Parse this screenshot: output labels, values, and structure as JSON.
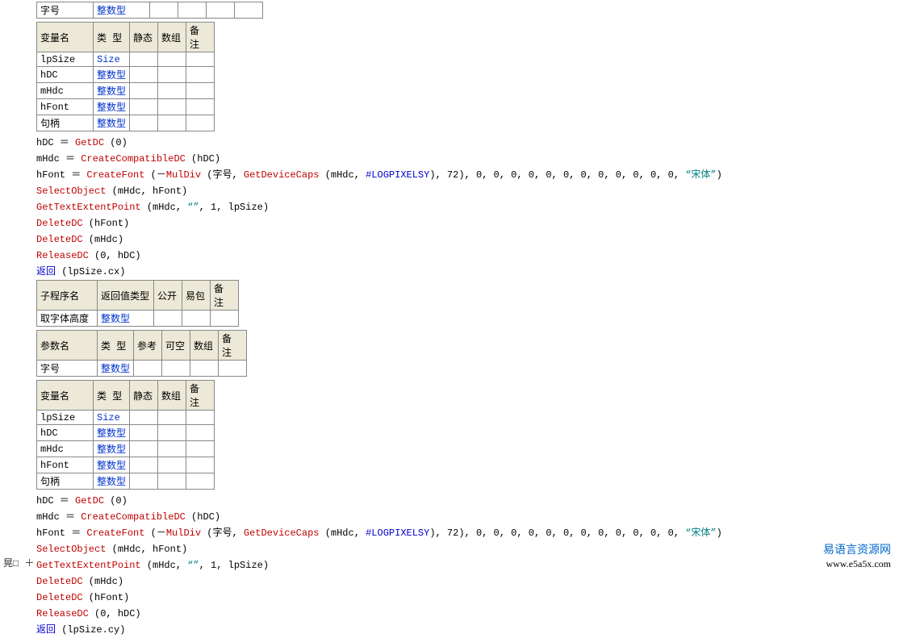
{
  "topRow": {
    "name": "字号",
    "type": "整数型"
  },
  "varHeaders": [
    "变量名",
    "类 型",
    "静态",
    "数组",
    "备 注"
  ],
  "vars1": [
    {
      "name": "lpSize",
      "type": "Size"
    },
    {
      "name": "hDC",
      "type": "整数型"
    },
    {
      "name": "mHdc",
      "type": "整数型"
    },
    {
      "name": "hFont",
      "type": "整数型"
    },
    {
      "name": "句柄",
      "type": "整数型"
    }
  ],
  "code1": {
    "l1a": "hDC ＝ ",
    "l1b": "GetDC",
    "l1c": " (0)",
    "l2a": "mHdc ＝ ",
    "l2b": "CreateCompatibleDC",
    "l2c": " (hDC)",
    "l3a": "hFont ＝ ",
    "l3b": "CreateFont",
    "l3c": " (－",
    "l3d": "MulDiv",
    "l3e": " (字号, ",
    "l3f": "GetDeviceCaps",
    "l3g": " (mHdc, ",
    "l3h": "#LOGPIXELSY",
    "l3i": "), 72), 0, 0, 0, 0, 0, 0, 0, 0, 0, 0, 0, 0, ",
    "l3j": "“宋体”",
    "l3k": ")",
    "l4a": "SelectObject",
    "l4b": " (mHdc, hFont)",
    "l5a": "GetTextExtentPoint",
    "l5b": " (mHdc, ",
    "l5c": "“”",
    "l5d": ", 1, lpSize)",
    "l6a": "DeleteDC",
    "l6b": " (hFont)",
    "l7a": "DeleteDC",
    "l7b": " (mHdc)",
    "l8a": "ReleaseDC",
    "l8b": " (0, hDC)",
    "l9a": "返回",
    "l9b": " (lpSize.cx)"
  },
  "subHeaders": [
    "子程序名",
    "返回值类型",
    "公开",
    "易包",
    "备 注"
  ],
  "subRow": {
    "name": "取字体高度",
    "type": "整数型"
  },
  "paramHeaders": [
    "参数名",
    "类 型",
    "参考",
    "可空",
    "数组",
    "备 注"
  ],
  "paramRow": {
    "name": "字号",
    "type": "整数型"
  },
  "vars2": [
    {
      "name": "lpSize",
      "type": "Size"
    },
    {
      "name": "hDC",
      "type": "整数型"
    },
    {
      "name": "mHdc",
      "type": "整数型"
    },
    {
      "name": "hFont",
      "type": "整数型"
    },
    {
      "name": "句柄",
      "type": "整数型"
    }
  ],
  "code2": {
    "l1a": "hDC ＝ ",
    "l1b": "GetDC",
    "l1c": " (0)",
    "l2a": "mHdc ＝ ",
    "l2b": "CreateCompatibleDC",
    "l2c": " (hDC)",
    "l3a": "hFont ＝ ",
    "l3b": "CreateFont",
    "l3c": " (－",
    "l3d": "MulDiv",
    "l3e": " (字号, ",
    "l3f": "GetDeviceCaps",
    "l3g": " (mHdc, ",
    "l3h": "#LOGPIXELSY",
    "l3i": "), 72), 0, 0, 0, 0, 0, 0, 0, 0, 0, 0, 0, 0, ",
    "l3j": "“宋体”",
    "l3k": ")",
    "l4a": "SelectObject",
    "l4b": " (mHdc, hFont)",
    "l5a": "GetTextExtentPoint",
    "l5b": " (mHdc, ",
    "l5c": "“”",
    "l5d": ", 1, lpSize)",
    "l6a": "DeleteDC",
    "l6b": " (mHdc)",
    "l7a": "DeleteDC",
    "l7b": " (hFont)",
    "l8a": "ReleaseDC",
    "l8b": " (0, hDC)",
    "l9a": "返回",
    "l9b": " (lpSize.cy)"
  },
  "watermark": {
    "title": "易语言资源网",
    "url": "www.e5a5x.com"
  },
  "gutter": "晃□ ＋"
}
